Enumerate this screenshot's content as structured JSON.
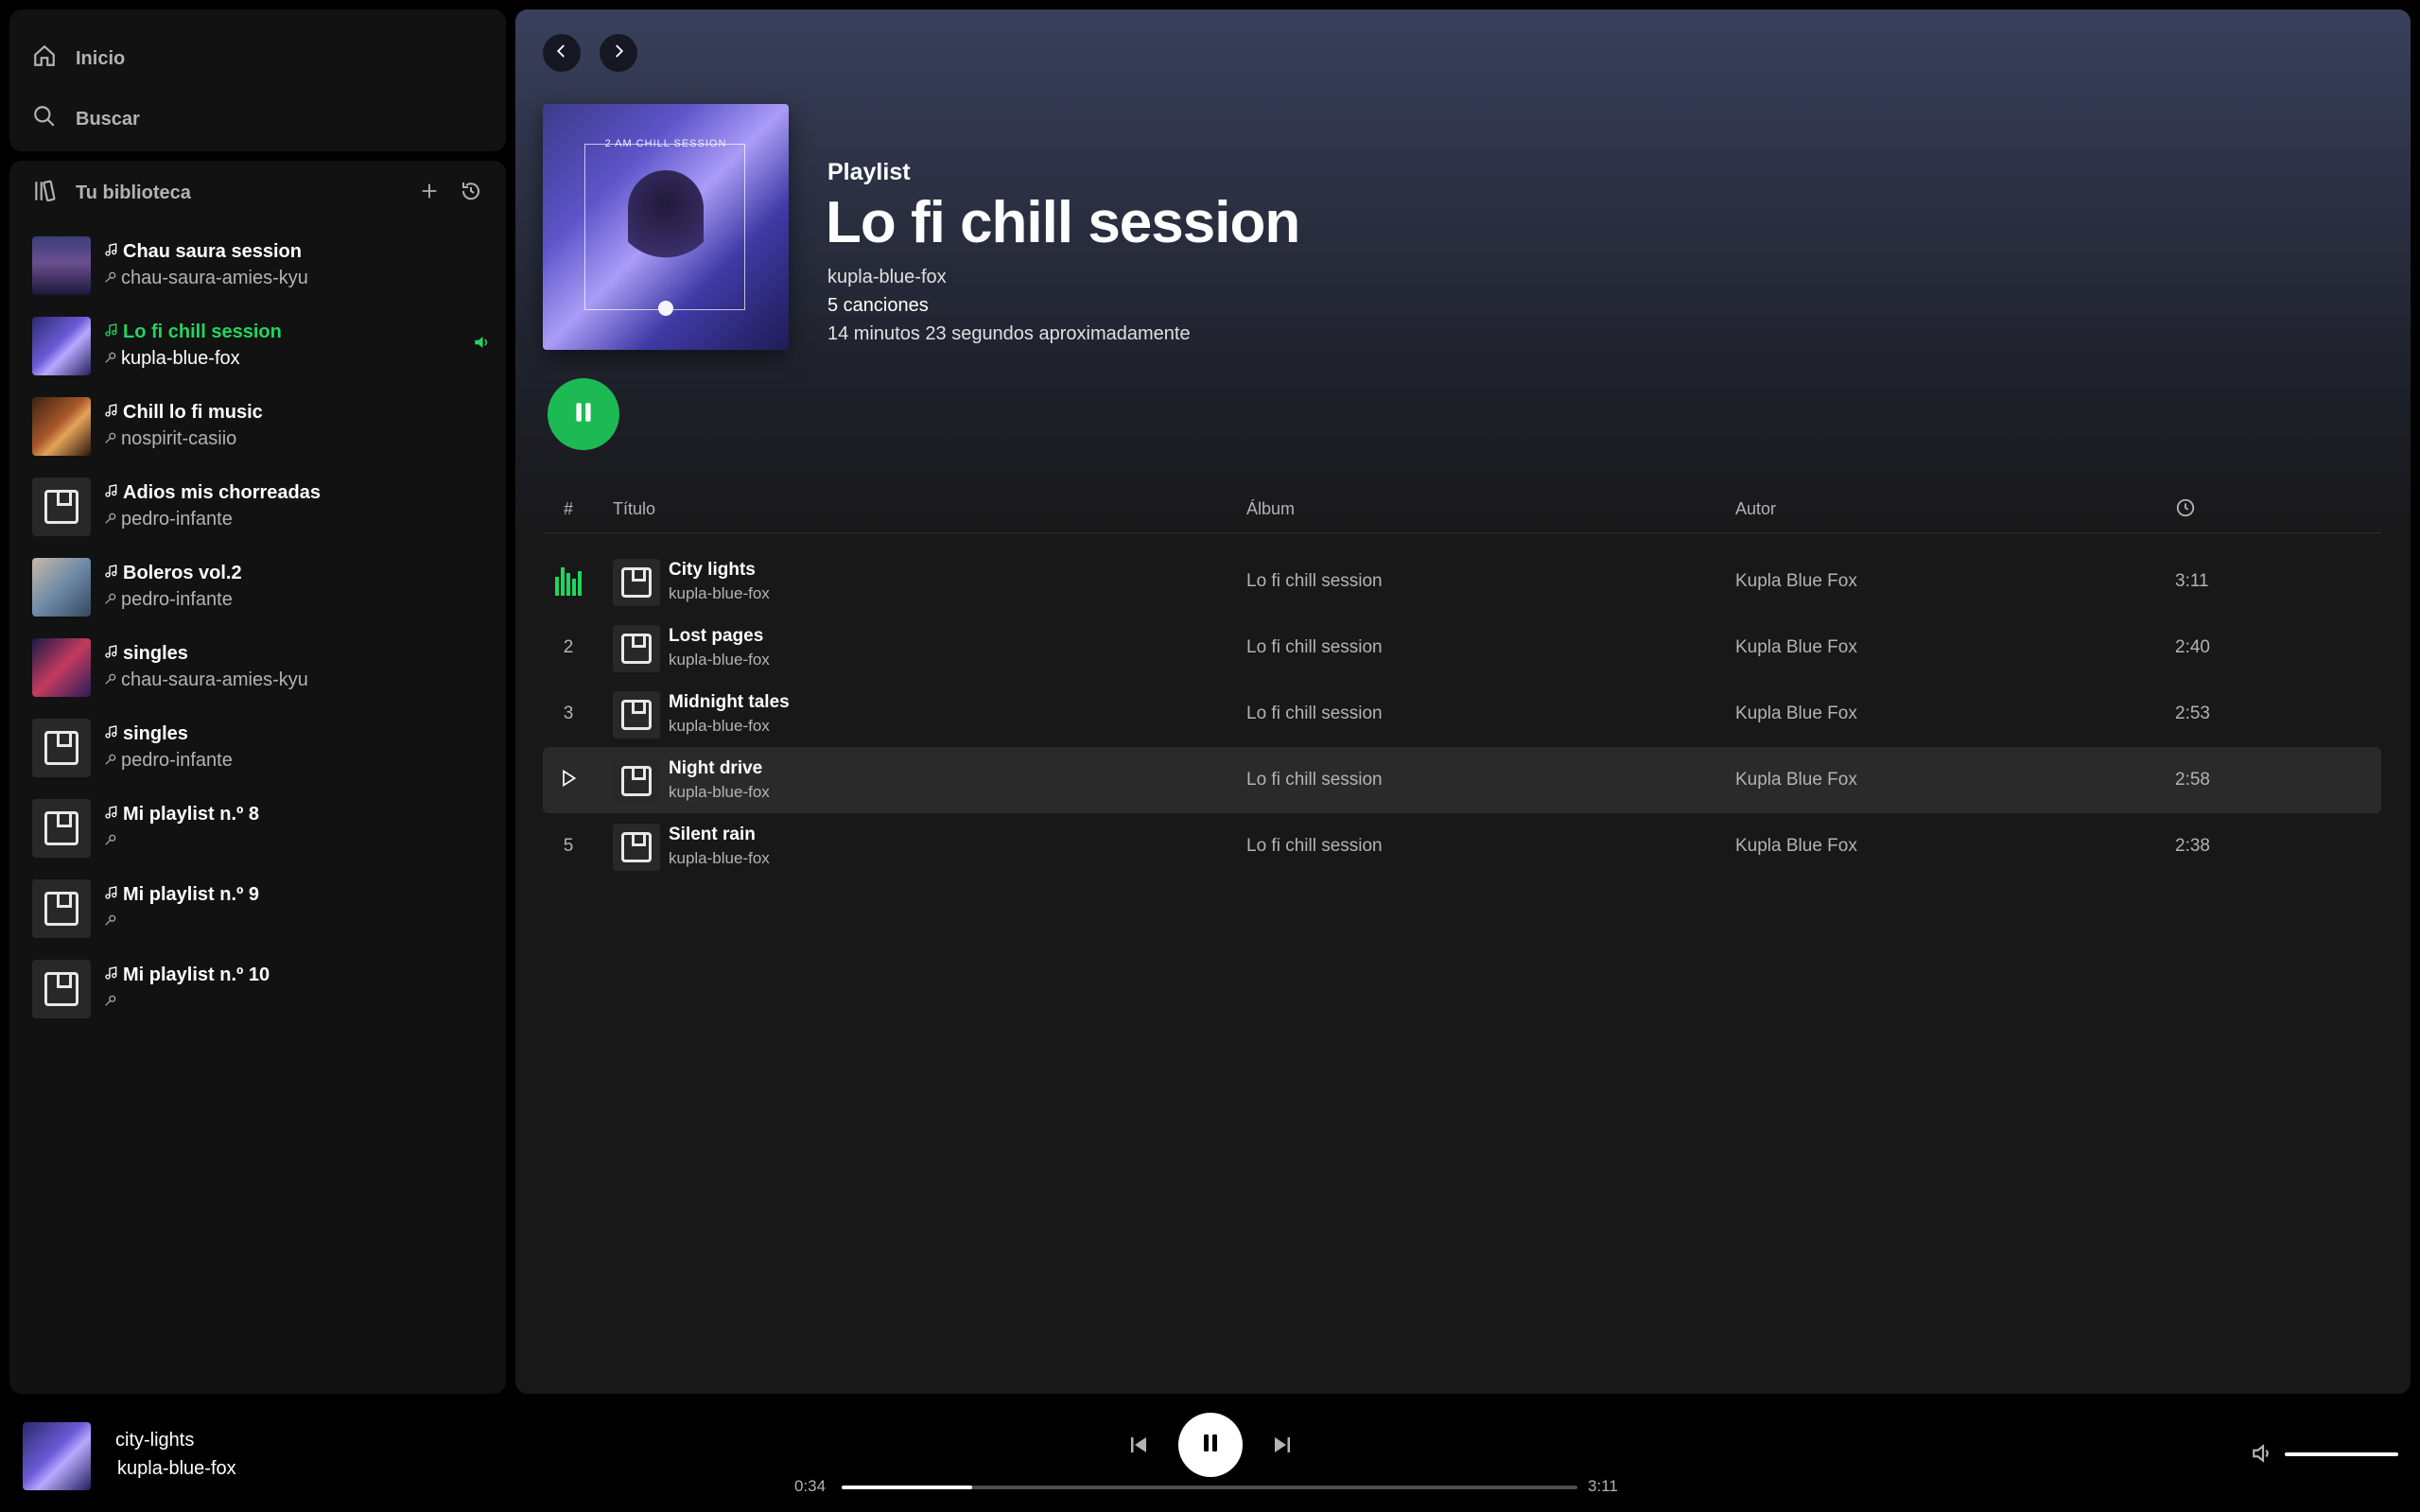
{
  "nav": {
    "home_label": "Inicio",
    "search_label": "Buscar",
    "home_icon": "home-icon",
    "search_icon": "search-icon"
  },
  "library": {
    "title": "Tu biblioteca",
    "items": [
      {
        "name": "Chau saura session",
        "owner": "chau-saura-amies-kyu",
        "cover": "g1",
        "active": false
      },
      {
        "name": "Lo fi chill session",
        "owner": "kupla-blue-fox",
        "cover": "g2",
        "active": true
      },
      {
        "name": "Chill lo fi music",
        "owner": "nospirit-casiio",
        "cover": "g3",
        "active": false
      },
      {
        "name": "Adios mis chorreadas",
        "owner": "pedro-infante",
        "cover": "placeholder",
        "active": false
      },
      {
        "name": "Boleros vol.2",
        "owner": "pedro-infante",
        "cover": "g4",
        "active": false
      },
      {
        "name": "singles",
        "owner": "chau-saura-amies-kyu",
        "cover": "g5",
        "active": false
      },
      {
        "name": "singles",
        "owner": "pedro-infante",
        "cover": "placeholder",
        "active": false
      },
      {
        "name": "Mi playlist n.º 8",
        "owner": "",
        "cover": "placeholder",
        "active": false
      },
      {
        "name": "Mi playlist n.º 9",
        "owner": "",
        "cover": "placeholder",
        "active": false
      },
      {
        "name": "Mi playlist n.º 10",
        "owner": "",
        "cover": "placeholder",
        "active": false
      }
    ]
  },
  "playlist": {
    "type_label": "Playlist",
    "title": "Lo fi chill session",
    "owner": "kupla-blue-fox",
    "count": "5 canciones",
    "duration": "14 minutos 23 segundos aproximadamente",
    "cover_caption": "2 AM CHILL SESSION"
  },
  "table": {
    "headers": {
      "num": "#",
      "title": "Título",
      "album": "Álbum",
      "author": "Autor"
    },
    "tracks": [
      {
        "num": "1",
        "title": "City lights",
        "artist": "kupla-blue-fox",
        "album": "Lo fi chill session",
        "author": "Kupla Blue Fox",
        "duration": "3:11",
        "state": "playing"
      },
      {
        "num": "2",
        "title": "Lost pages",
        "artist": "kupla-blue-fox",
        "album": "Lo fi chill session",
        "author": "Kupla Blue Fox",
        "duration": "2:40",
        "state": "normal"
      },
      {
        "num": "3",
        "title": "Midnight tales",
        "artist": "kupla-blue-fox",
        "album": "Lo fi chill session",
        "author": "Kupla Blue Fox",
        "duration": "2:53",
        "state": "normal"
      },
      {
        "num": "4",
        "title": "Night drive",
        "artist": "kupla-blue-fox",
        "album": "Lo fi chill session",
        "author": "Kupla Blue Fox",
        "duration": "2:58",
        "state": "hover"
      },
      {
        "num": "5",
        "title": "Silent rain",
        "artist": "kupla-blue-fox",
        "album": "Lo fi chill session",
        "author": "Kupla Blue Fox",
        "duration": "2:38",
        "state": "normal"
      }
    ]
  },
  "player": {
    "track_title": "city-lights",
    "track_artist": "kupla-blue-fox",
    "current_time": "0:34",
    "total_time": "3:11",
    "progress_fraction": 0.178,
    "volume_fraction": 1.0
  },
  "colors": {
    "accent": "#1ed760",
    "play_button": "#1db954",
    "panel": "#121212",
    "background": "#000000"
  }
}
